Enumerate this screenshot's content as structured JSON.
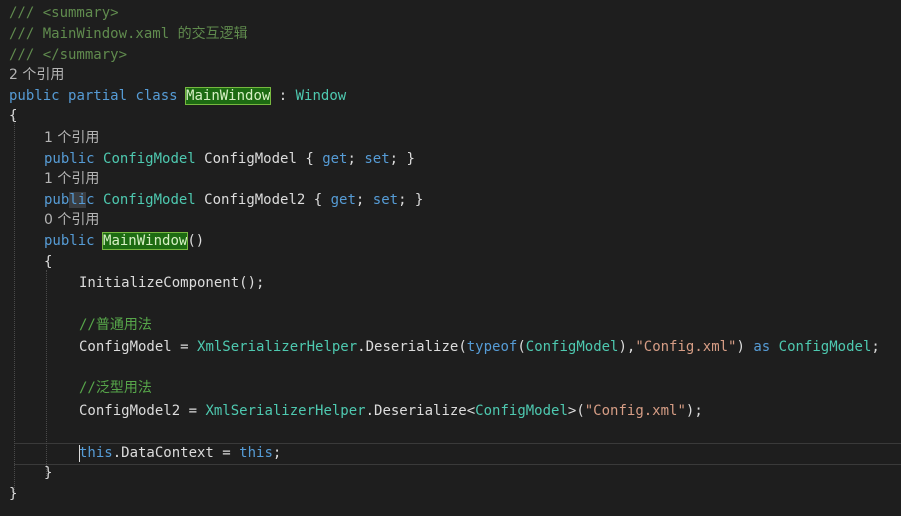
{
  "editor": {
    "lines": [
      {
        "kind": "code",
        "segments": [
          {
            "t": "/// ",
            "c": "cmt"
          },
          {
            "t": "<summary>",
            "c": "cmt"
          }
        ]
      },
      {
        "kind": "code",
        "segments": [
          {
            "t": "/// MainWindow.xaml 的交互逻辑",
            "c": "cmt"
          }
        ]
      },
      {
        "kind": "code",
        "segments": [
          {
            "t": "/// ",
            "c": "cmt"
          },
          {
            "t": "</summary>",
            "c": "cmt"
          }
        ]
      },
      {
        "kind": "lens",
        "text": "2 个引用"
      },
      {
        "kind": "code",
        "segments": [
          {
            "t": "public ",
            "c": "kw"
          },
          {
            "t": "partial ",
            "c": "kw"
          },
          {
            "t": "class ",
            "c": "kw"
          },
          {
            "t": "MainWindow",
            "c": "hl"
          },
          {
            "t": " : ",
            "c": "id"
          },
          {
            "t": "Window",
            "c": "ty"
          }
        ]
      },
      {
        "kind": "code",
        "segments": [
          {
            "t": "{",
            "c": "id"
          }
        ]
      },
      {
        "kind": "lens",
        "text": "1 个引用"
      },
      {
        "kind": "code",
        "segments": [
          {
            "t": "public ",
            "c": "kw"
          },
          {
            "t": "ConfigModel ",
            "c": "ty"
          },
          {
            "t": "ConfigModel { ",
            "c": "id"
          },
          {
            "t": "get",
            "c": "kw"
          },
          {
            "t": "; ",
            "c": "id"
          },
          {
            "t": "set",
            "c": "kw"
          },
          {
            "t": "; }",
            "c": "id"
          }
        ]
      },
      {
        "kind": "lens",
        "text": "1 个引用"
      },
      {
        "kind": "code",
        "segments": [
          {
            "t": "pub",
            "c": "kw"
          },
          {
            "t": "li",
            "c": "selkw"
          },
          {
            "t": "c ",
            "c": "kw"
          },
          {
            "t": "ConfigModel ",
            "c": "ty"
          },
          {
            "t": "ConfigModel2 { ",
            "c": "id"
          },
          {
            "t": "get",
            "c": "kw"
          },
          {
            "t": "; ",
            "c": "id"
          },
          {
            "t": "set",
            "c": "kw"
          },
          {
            "t": "; }",
            "c": "id"
          }
        ]
      },
      {
        "kind": "lens",
        "text": "0 个引用"
      },
      {
        "kind": "code",
        "segments": [
          {
            "t": "public ",
            "c": "kw"
          },
          {
            "t": "MainWindow",
            "c": "hl"
          },
          {
            "t": "()",
            "c": "id"
          }
        ]
      },
      {
        "kind": "code",
        "segments": [
          {
            "t": "{",
            "c": "id"
          }
        ]
      },
      {
        "kind": "code",
        "segments": [
          {
            "t": "InitializeComponent();",
            "c": "id"
          }
        ]
      },
      {
        "kind": "code",
        "segments": []
      },
      {
        "kind": "code",
        "segments": [
          {
            "t": "//普通用法",
            "c": "cm"
          }
        ]
      },
      {
        "kind": "code",
        "segments": [
          {
            "t": "ConfigModel = ",
            "c": "id"
          },
          {
            "t": "XmlSerializerHelper",
            "c": "ty"
          },
          {
            "t": ".Deserialize(",
            "c": "id"
          },
          {
            "t": "typeof",
            "c": "kw"
          },
          {
            "t": "(",
            "c": "id"
          },
          {
            "t": "ConfigModel",
            "c": "ty"
          },
          {
            "t": "),",
            "c": "id"
          },
          {
            "t": "\"Config.xml\"",
            "c": "str"
          },
          {
            "t": ") ",
            "c": "id"
          },
          {
            "t": "as ",
            "c": "kw"
          },
          {
            "t": "ConfigModel",
            "c": "ty"
          },
          {
            "t": ";",
            "c": "id"
          }
        ]
      },
      {
        "kind": "code",
        "segments": []
      },
      {
        "kind": "code",
        "segments": [
          {
            "t": "//泛型用法",
            "c": "cm"
          }
        ]
      },
      {
        "kind": "code",
        "segments": [
          {
            "t": "ConfigModel2 = ",
            "c": "id"
          },
          {
            "t": "XmlSerializerHelper",
            "c": "ty"
          },
          {
            "t": ".Deserialize<",
            "c": "id"
          },
          {
            "t": "ConfigModel",
            "c": "ty"
          },
          {
            "t": ">(",
            "c": "id"
          },
          {
            "t": "\"Config.xml\"",
            "c": "str"
          },
          {
            "t": ");",
            "c": "id"
          }
        ]
      },
      {
        "kind": "code",
        "segments": []
      },
      {
        "kind": "code",
        "segments": [
          {
            "t": "this",
            "c": "kw"
          },
          {
            "t": ".DataContext = ",
            "c": "id"
          },
          {
            "t": "this",
            "c": "kw"
          },
          {
            "t": ";",
            "c": "id"
          }
        ]
      },
      {
        "kind": "code",
        "segments": [
          {
            "t": "}",
            "c": "id"
          }
        ]
      },
      {
        "kind": "code",
        "segments": [
          {
            "t": "}",
            "c": "id"
          }
        ]
      }
    ]
  }
}
